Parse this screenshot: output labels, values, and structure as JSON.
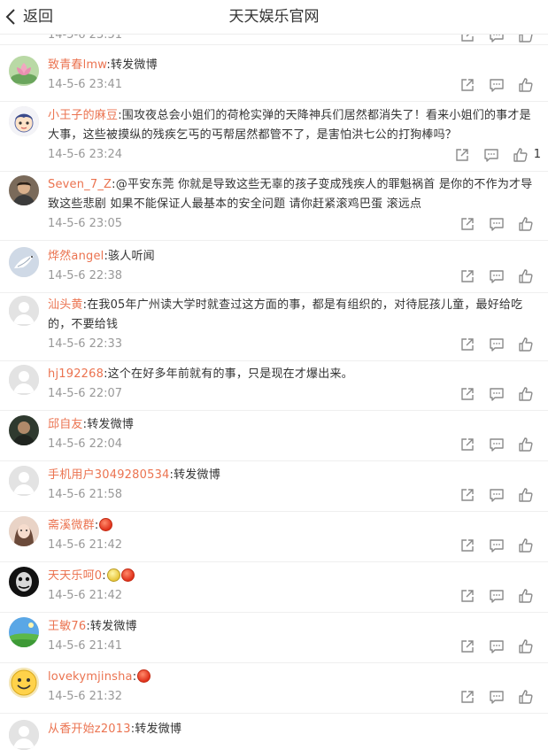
{
  "header": {
    "back_label": "返回",
    "title": "天天娱乐官网"
  },
  "partial_top": {
    "time": "14-5-6 23:51"
  },
  "comments": [
    {
      "user": "致青春lmw",
      "avatar": "lotus",
      "text": ":转发微博",
      "time": "14-5-6 23:41",
      "likes": ""
    },
    {
      "user": "小王子的麻豆",
      "avatar": "cartoon",
      "text": ":围攻夜总会小姐们的荷枪实弹的天降神兵们居然都消失了！看来小姐们的事才是大事，这些被摸纵的残疾乞丐的丐帮居然都管不了，是害怕洪七公的打狗棒吗？",
      "time": "14-5-6 23:24",
      "likes": "1"
    },
    {
      "user": "Seven_7_Z",
      "avatar": "man",
      "text": ":@平安东莞 你就是导致这些无辜的孩子变成残疾人的罪魁祸首 是你的不作为才导致这些悲剧 如果不能保证人最基本的安全问题 请你赶紧滚鸡巴蛋 滚远点",
      "time": "14-5-6 23:05",
      "likes": ""
    },
    {
      "user": "烨然angel",
      "avatar": "bird",
      "text": ":骇人听闻",
      "time": "14-5-6 22:38",
      "likes": ""
    },
    {
      "user": "汕头黄",
      "avatar": "default",
      "text": ":在我05年广州读大学时就查过这方面的事，都是有组织的，对待屁孩儿童，最好给吃的，不要给钱",
      "time": "14-5-6 22:33",
      "likes": ""
    },
    {
      "user": "hj192268",
      "avatar": "default",
      "text": ":这个在好多年前就有的事，只是现在才爆出来。",
      "time": "14-5-6 22:07",
      "likes": ""
    },
    {
      "user": "邱自友",
      "avatar": "dark",
      "text": ":转发微博",
      "time": "14-5-6 22:04",
      "likes": ""
    },
    {
      "user": "手机用户3049280534",
      "avatar": "default",
      "text": ":转发微博",
      "time": "14-5-6 21:58",
      "likes": ""
    },
    {
      "user": "斋溪微群",
      "avatar": "girl",
      "text": ":",
      "emojis": [
        "red"
      ],
      "time": "14-5-6 21:42",
      "likes": ""
    },
    {
      "user": "天天乐呵0",
      "avatar": "joker",
      "text": ":",
      "emojis": [
        "yellow",
        "red"
      ],
      "time": "14-5-6 21:42",
      "likes": ""
    },
    {
      "user": "王敏76",
      "avatar": "landscape",
      "text": ":转发微博",
      "time": "14-5-6 21:41",
      "likes": ""
    },
    {
      "user": "lovekymjinsha",
      "avatar": "smiley",
      "text": ":",
      "emojis": [
        "red"
      ],
      "time": "14-5-6 21:32",
      "likes": ""
    }
  ],
  "partial_bottom": {
    "user": "从香开始z2013",
    "text": ":转发微博"
  },
  "colors": {
    "username": "#eb7350",
    "time": "#999999",
    "text": "#333333",
    "icon": "#888888"
  },
  "icons": {
    "back": "chevron-left-icon",
    "forward": "forward-icon",
    "comment": "comment-icon",
    "like": "thumb-up-icon"
  }
}
